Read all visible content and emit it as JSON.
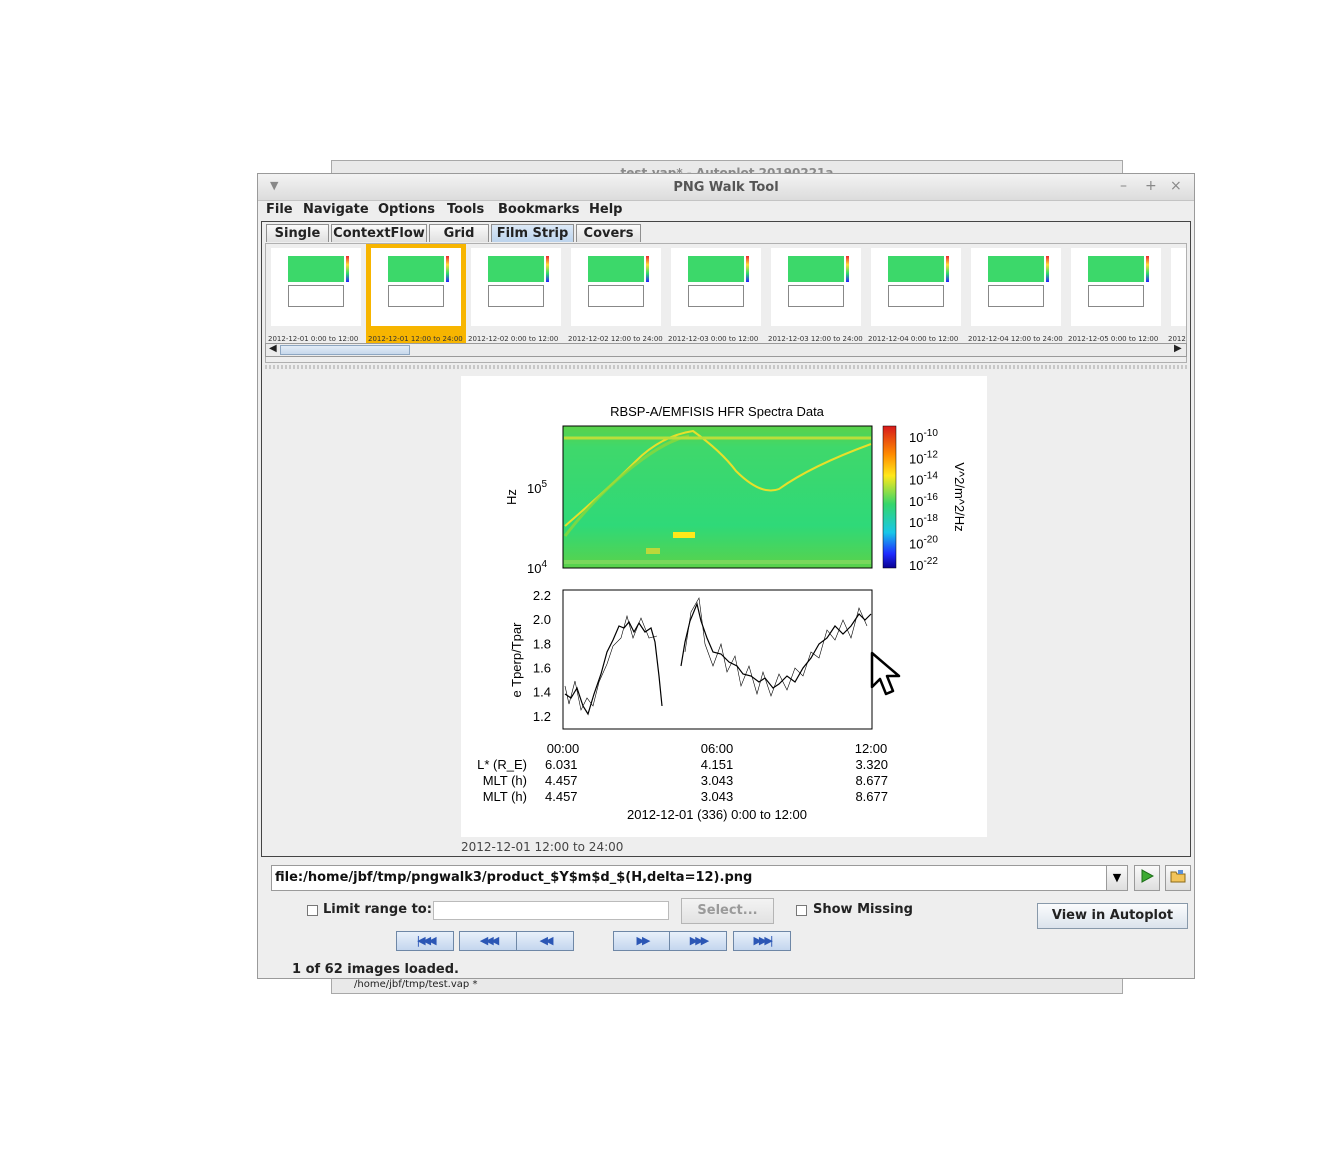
{
  "background_window": {
    "title": "test.vap* - Autoplot 20190221a",
    "status_path": "/home/jbf/tmp/test.vap *"
  },
  "window": {
    "title": "PNG Walk Tool",
    "controls": {
      "minimize": "–",
      "maximize": "+",
      "close": "×"
    }
  },
  "menu": [
    "File",
    "Navigate",
    "Options",
    "Tools",
    "Bookmarks",
    "Help"
  ],
  "tabs": [
    {
      "label": "Single",
      "selected": false
    },
    {
      "label": "ContextFlow",
      "selected": false
    },
    {
      "label": "Grid",
      "selected": false
    },
    {
      "label": "Film Strip",
      "selected": true
    },
    {
      "label": "Covers",
      "selected": false
    }
  ],
  "thumbnails": [
    {
      "label": "2012-12-01 0:00 to 12:00",
      "selected": false
    },
    {
      "label": "2012-12-01 12:00 to 24:00",
      "selected": true
    },
    {
      "label": "2012-12-02 0:00 to 12:00",
      "selected": false
    },
    {
      "label": "2012-12-02 12:00 to 24:00",
      "selected": false
    },
    {
      "label": "2012-12-03 0:00 to 12:00",
      "selected": false
    },
    {
      "label": "2012-12-03 12:00 to 24:00",
      "selected": false
    },
    {
      "label": "2012-12-04 0:00 to 12:00",
      "selected": false
    },
    {
      "label": "2012-12-04 12:00 to 24:00",
      "selected": false
    },
    {
      "label": "2012-12-05 0:00 to 12:00",
      "selected": false
    },
    {
      "label": "2012",
      "selected": false
    }
  ],
  "main_image": {
    "title": "RBSP-A/EMFISIS  HFR Spectra Data",
    "spectrogram": {
      "ylabel": "Hz",
      "yticks": [
        {
          "base": "10",
          "exp": "5"
        },
        {
          "base": "10",
          "exp": "4"
        }
      ],
      "colorbar_ticks": [
        {
          "base": "10",
          "exp": "-10"
        },
        {
          "base": "10",
          "exp": "-12"
        },
        {
          "base": "10",
          "exp": "-14"
        },
        {
          "base": "10",
          "exp": "-16"
        },
        {
          "base": "10",
          "exp": "-18"
        },
        {
          "base": "10",
          "exp": "-20"
        },
        {
          "base": "10",
          "exp": "-22"
        }
      ],
      "colorbar_label": "V^2/m^2/Hz"
    },
    "lineplot": {
      "ylabel": "e Tperp/Tpar",
      "yticks": [
        "2.2",
        "2.0",
        "1.8",
        "1.6",
        "1.4",
        "1.2"
      ],
      "ylim": [
        1.1,
        2.25
      ]
    },
    "xticks": [
      "00:00",
      "06:00",
      "12:00"
    ],
    "ephemeris": [
      {
        "label": "L* (R_E)",
        "values": [
          "6.031",
          "4.151",
          "3.320"
        ]
      },
      {
        "label": "MLT (h)",
        "values": [
          "4.457",
          "3.043",
          "8.677"
        ]
      },
      {
        "label": "MLT (h)",
        "values": [
          "4.457",
          "3.043",
          "8.677"
        ]
      }
    ],
    "xlabel": "2012-12-01 (336) 0:00 to 12:00"
  },
  "caption": "2012-12-01 12:00 to 24:00",
  "url_template": "file:/home/jbf/tmp/pngwalk3/product_$Y$m$d_$(H,delta=12).png",
  "controls": {
    "limit_range_label": "Limit range to:",
    "limit_range_checked": false,
    "limit_range_value": "",
    "select_button": "Select...",
    "show_missing_label": "Show Missing",
    "show_missing_checked": false,
    "view_in_autoplot": "View in Autoplot"
  },
  "nav_buttons": [
    {
      "name": "first",
      "glyph": "|◀◀◀"
    },
    {
      "name": "prev-page",
      "glyph": "◀◀◀"
    },
    {
      "name": "prev",
      "glyph": "◀◀"
    },
    {
      "name": "next",
      "glyph": "▶▶"
    },
    {
      "name": "next-page",
      "glyph": "▶▶▶"
    },
    {
      "name": "last",
      "glyph": "▶▶▶|"
    }
  ],
  "status": "1 of 62 images loaded."
}
